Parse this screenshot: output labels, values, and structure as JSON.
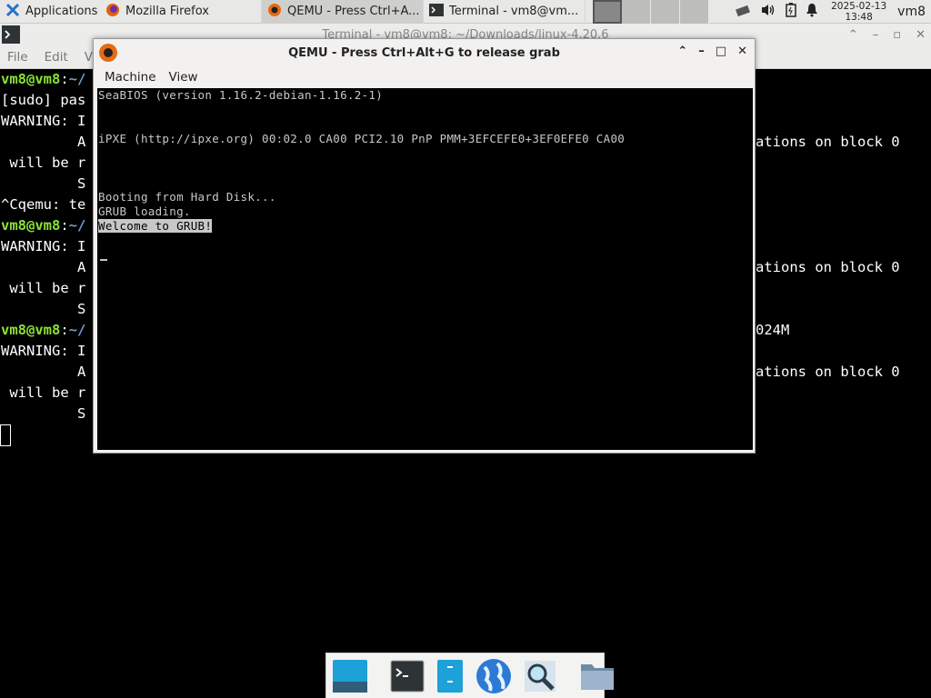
{
  "panel": {
    "applications_label": "Applications",
    "tasks": [
      {
        "label": "Mozilla Firefox"
      },
      {
        "label": "QEMU - Press Ctrl+A..."
      },
      {
        "label": "Terminal - vm8@vm..."
      }
    ],
    "clock_date": "2025-02-13",
    "clock_time": "13:48",
    "user": "vm8"
  },
  "terminal": {
    "title": "Terminal - vm8@vm8: ~/Downloads/linux-4.20.6",
    "menu": [
      "File",
      "Edit",
      "Vi"
    ],
    "lines": [
      {
        "prompt": "vm8@vm8",
        "sep": ":",
        "path": "~/",
        "text": ""
      },
      {
        "prompt": "",
        "sep": "",
        "path": "",
        "text": "[sudo] pas"
      },
      {
        "prompt": "",
        "sep": "",
        "path": "",
        "text": "WARNING: I"
      },
      {
        "prompt": "",
        "sep": "",
        "path": "",
        "text": "         A"
      },
      {
        "prompt": "",
        "sep": "",
        "path": "",
        "text": " will be r"
      },
      {
        "prompt": "",
        "sep": "",
        "path": "",
        "text": "         S"
      },
      {
        "prompt": "",
        "sep": "",
        "path": "",
        "text": "^Cqemu: te"
      },
      {
        "prompt": "vm8@vm8",
        "sep": ":",
        "path": "~/",
        "text": ""
      },
      {
        "prompt": "",
        "sep": "",
        "path": "",
        "text": "WARNING: I"
      },
      {
        "prompt": "",
        "sep": "",
        "path": "",
        "text": "         A"
      },
      {
        "prompt": "",
        "sep": "",
        "path": "",
        "text": " will be r"
      },
      {
        "prompt": "",
        "sep": "",
        "path": "",
        "text": "         S"
      },
      {
        "prompt": "vm8@vm8",
        "sep": ":",
        "path": "~/",
        "text": ""
      },
      {
        "prompt": "",
        "sep": "",
        "path": "",
        "text": "WARNING: I"
      },
      {
        "prompt": "",
        "sep": "",
        "path": "",
        "text": "         A"
      },
      {
        "prompt": "",
        "sep": "",
        "path": "",
        "text": " will be r"
      },
      {
        "prompt": "",
        "sep": "",
        "path": "",
        "text": "         S"
      }
    ],
    "right_fragments": [
      {
        "row": 3,
        "text": "ations on block 0"
      },
      {
        "row": 9,
        "text": "ations on block 0"
      },
      {
        "row": 12,
        "text": "024M"
      },
      {
        "row": 14,
        "text": "ations on block 0"
      }
    ]
  },
  "qemu": {
    "title": "QEMU - Press Ctrl+Alt+G to release grab",
    "menu": [
      "Machine",
      "View"
    ],
    "screen_lines": [
      {
        "text": "SeaBIOS (version 1.16.2-debian-1.16.2-1)",
        "highlight": false
      },
      {
        "text": "",
        "highlight": false
      },
      {
        "text": "",
        "highlight": false
      },
      {
        "text": "iPXE (http://ipxe.org) 00:02.0 CA00 PCI2.10 PnP PMM+3EFCEFE0+3EF0EFE0 CA00",
        "highlight": false
      },
      {
        "text": "",
        "highlight": false
      },
      {
        "text": "",
        "highlight": false
      },
      {
        "text": "",
        "highlight": false
      },
      {
        "text": "Booting from Hard Disk...",
        "highlight": false
      },
      {
        "text": "GRUB loading.",
        "highlight": false
      },
      {
        "text": "Welcome to GRUB!",
        "highlight": true
      }
    ]
  },
  "dock": {
    "items": [
      "show-desktop",
      "terminal",
      "file-manager",
      "web-browser",
      "app-finder",
      "files-folder"
    ]
  }
}
